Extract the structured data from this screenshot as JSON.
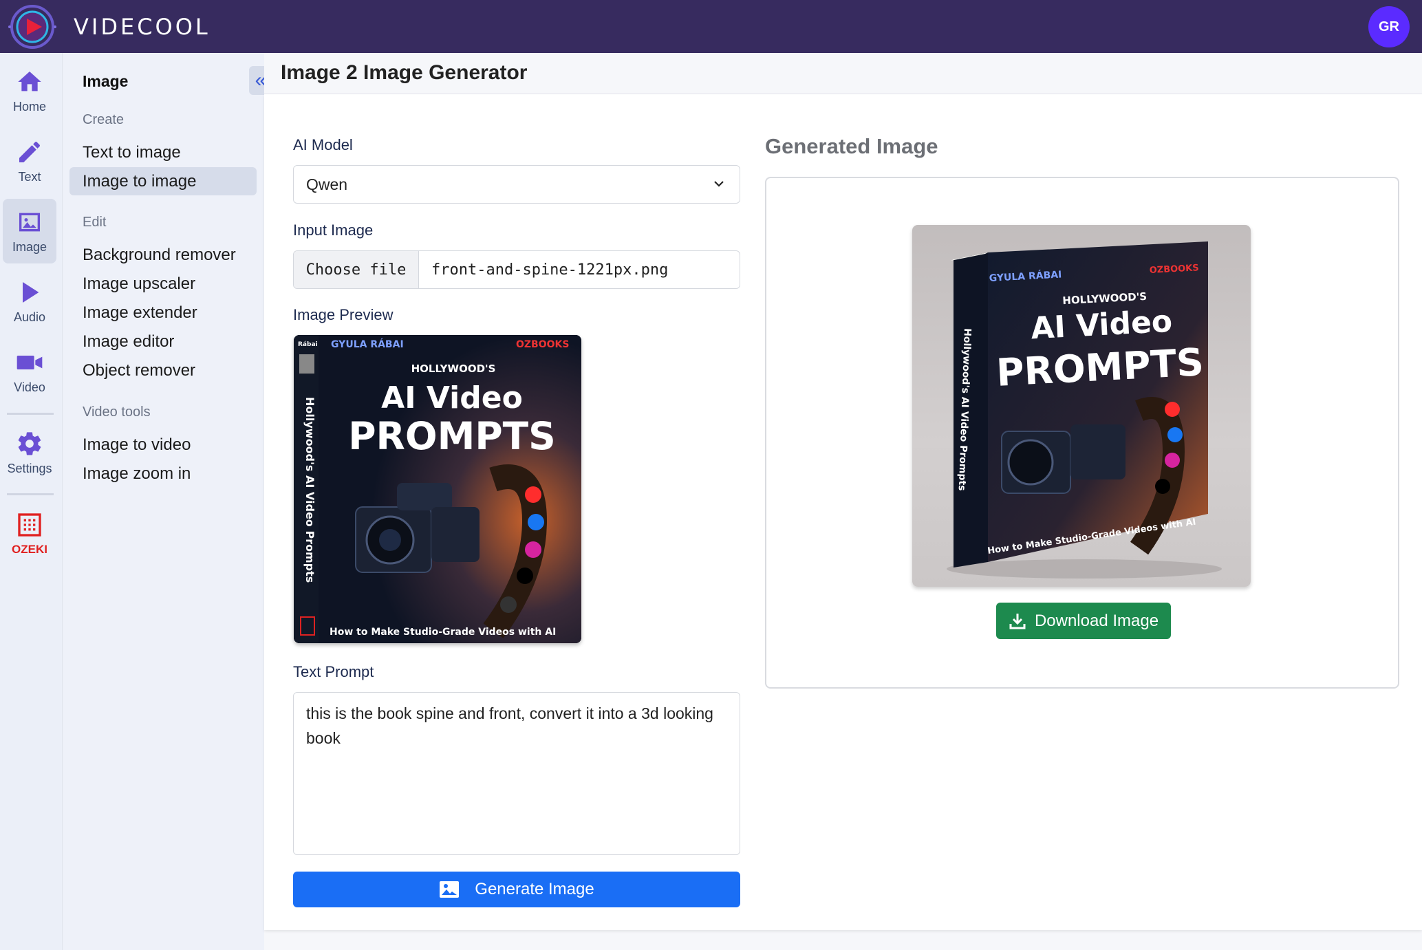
{
  "app": {
    "brand": "VIDECOOL",
    "avatar_initials": "GR",
    "colors": {
      "topbar": "#372b5f",
      "accent": "#1a6ef5",
      "download": "#1d8a4e",
      "avatar": "#5b2bff"
    }
  },
  "rail": {
    "items": [
      {
        "label": "Home",
        "icon": "home-icon"
      },
      {
        "label": "Text",
        "icon": "pencil-icon"
      },
      {
        "label": "Image",
        "icon": "image-icon"
      },
      {
        "label": "Audio",
        "icon": "play-icon"
      },
      {
        "label": "Video",
        "icon": "video-camera-icon"
      },
      {
        "label": "Settings",
        "icon": "gear-icon"
      },
      {
        "label": "OZEKI",
        "icon": "ozeki-logo-icon"
      }
    ]
  },
  "submenu": {
    "title": "Image",
    "groups": [
      {
        "label": "Create",
        "items": [
          "Text to image",
          "Image to image"
        ]
      },
      {
        "label": "Edit",
        "items": [
          "Background remover",
          "Image upscaler",
          "Image extender",
          "Image editor",
          "Object remover"
        ]
      },
      {
        "label": "Video tools",
        "items": [
          "Image to video",
          "Image zoom in"
        ]
      }
    ],
    "active_item": "Image to image"
  },
  "page": {
    "title": "Image 2 Image Generator"
  },
  "form": {
    "model_label": "AI Model",
    "model_value": "Qwen",
    "input_label": "Input Image",
    "file_button": "Choose file",
    "file_name": "front-and-spine-1221px.png",
    "preview_label": "Image Preview",
    "prompt_label": "Text Prompt",
    "prompt_value": "this is the book spine and front, convert it into a 3d looking book",
    "generate_button": "Generate Image"
  },
  "result": {
    "title": "Generated Image",
    "download_button": "Download Image"
  },
  "book": {
    "author": "GYULA RÁBAI",
    "publisher": "OZBOOKS",
    "series": "HOLLYWOOD'S",
    "title_line1": "AI Video",
    "title_line2": "PROMPTS",
    "subtitle": "How to Make Studio-Grade Videos with AI",
    "spine_text": "Hollywood's AI Video Prompts",
    "spine_author": "Rábai"
  }
}
